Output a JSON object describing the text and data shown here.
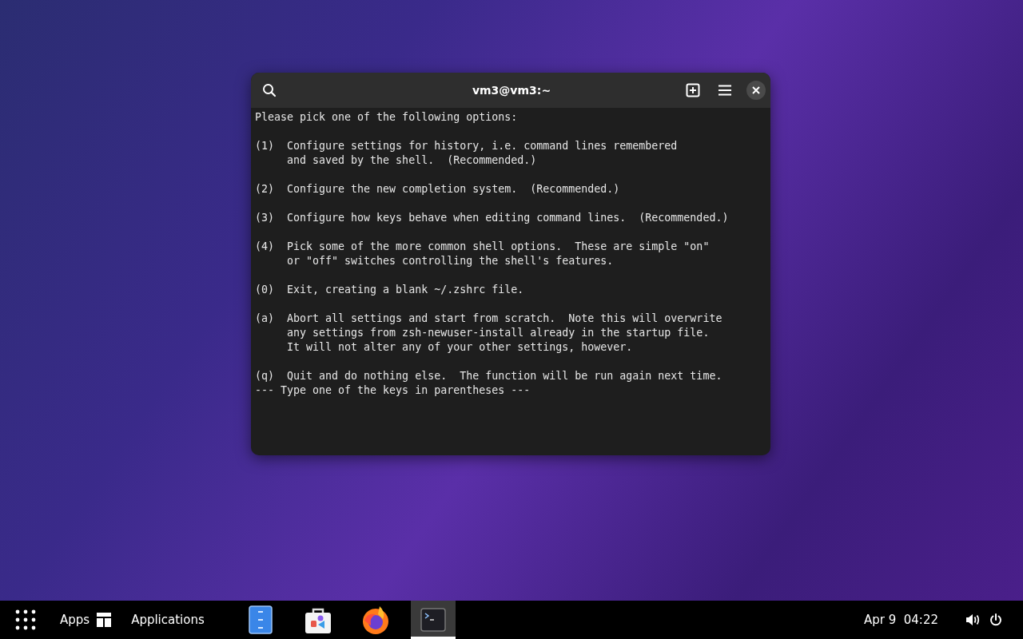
{
  "window": {
    "title": "vm3@vm3:~",
    "output": [
      {
        "lines": [
          "Please pick one of the following options:"
        ]
      },
      {
        "lines": [
          "(1)  Configure settings for history, i.e. command lines remembered",
          "     and saved by the shell.  (Recommended.)"
        ]
      },
      {
        "lines": [
          "(2)  Configure the new completion system.  (Recommended.)"
        ]
      },
      {
        "lines": [
          "(3)  Configure how keys behave when editing command lines.  (Recommended.)"
        ]
      },
      {
        "lines": [
          "(4)  Pick some of the more common shell options.  These are simple \"on\"",
          "     or \"off\" switches controlling the shell's features."
        ]
      },
      {
        "lines": [
          "(0)  Exit, creating a blank ~/.zshrc file."
        ]
      },
      {
        "lines": [
          "(a)  Abort all settings and start from scratch.  Note this will overwrite",
          "     any settings from zsh-newuser-install already in the startup file.",
          "     It will not alter any of your other settings, however."
        ]
      },
      {
        "lines": [
          "(q)  Quit and do nothing else.  The function will be run again next time.",
          "--- Type one of the keys in parentheses ---"
        ]
      }
    ]
  },
  "taskbar": {
    "menus": [
      {
        "label": "Apps"
      },
      {
        "label": "Applications"
      }
    ],
    "dock": [
      {
        "kind": "files",
        "selected": false
      },
      {
        "kind": "store",
        "selected": false
      },
      {
        "kind": "browser",
        "selected": false
      },
      {
        "kind": "terminal",
        "selected": true
      }
    ],
    "clock": "Apr 9  04:22"
  }
}
